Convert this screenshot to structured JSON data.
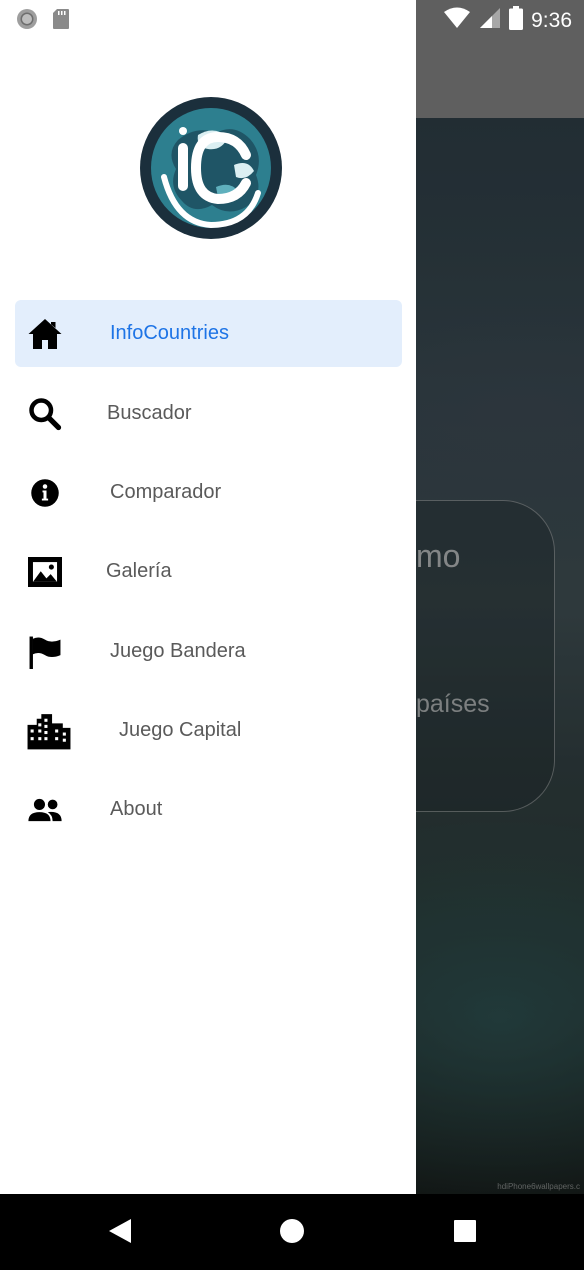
{
  "status_bar": {
    "time": "9:36",
    "left_icons": [
      "sync-circle-icon",
      "sd-card-icon"
    ],
    "right_icons": [
      "wifi-icon",
      "signal-icon",
      "battery-icon"
    ]
  },
  "background_app": {
    "card_text_line1": "mo",
    "card_text_line2": "países",
    "watermark": "hdiPhone6wallpapers.c"
  },
  "drawer": {
    "logo_name": "infocountries-logo",
    "items": [
      {
        "label": "InfoCountries",
        "icon": "home-icon",
        "active": true
      },
      {
        "label": "Buscador",
        "icon": "search-icon",
        "active": false
      },
      {
        "label": "Comparador",
        "icon": "info-icon",
        "active": false
      },
      {
        "label": "Galería",
        "icon": "image-icon",
        "active": false
      },
      {
        "label": "Juego Bandera",
        "icon": "flag-icon",
        "active": false
      },
      {
        "label": "Juego Capital",
        "icon": "city-icon",
        "active": false
      },
      {
        "label": "About",
        "icon": "people-icon",
        "active": false
      }
    ]
  },
  "nav_bar": {
    "buttons": [
      "back-icon",
      "home-circle-icon",
      "recents-icon"
    ]
  },
  "colors": {
    "accent": "#1e74e6",
    "active_bg": "#e3eefc",
    "label": "#5a5a5a",
    "logo_dark": "#1b2f3c",
    "logo_teal": "#2d7f8f"
  }
}
